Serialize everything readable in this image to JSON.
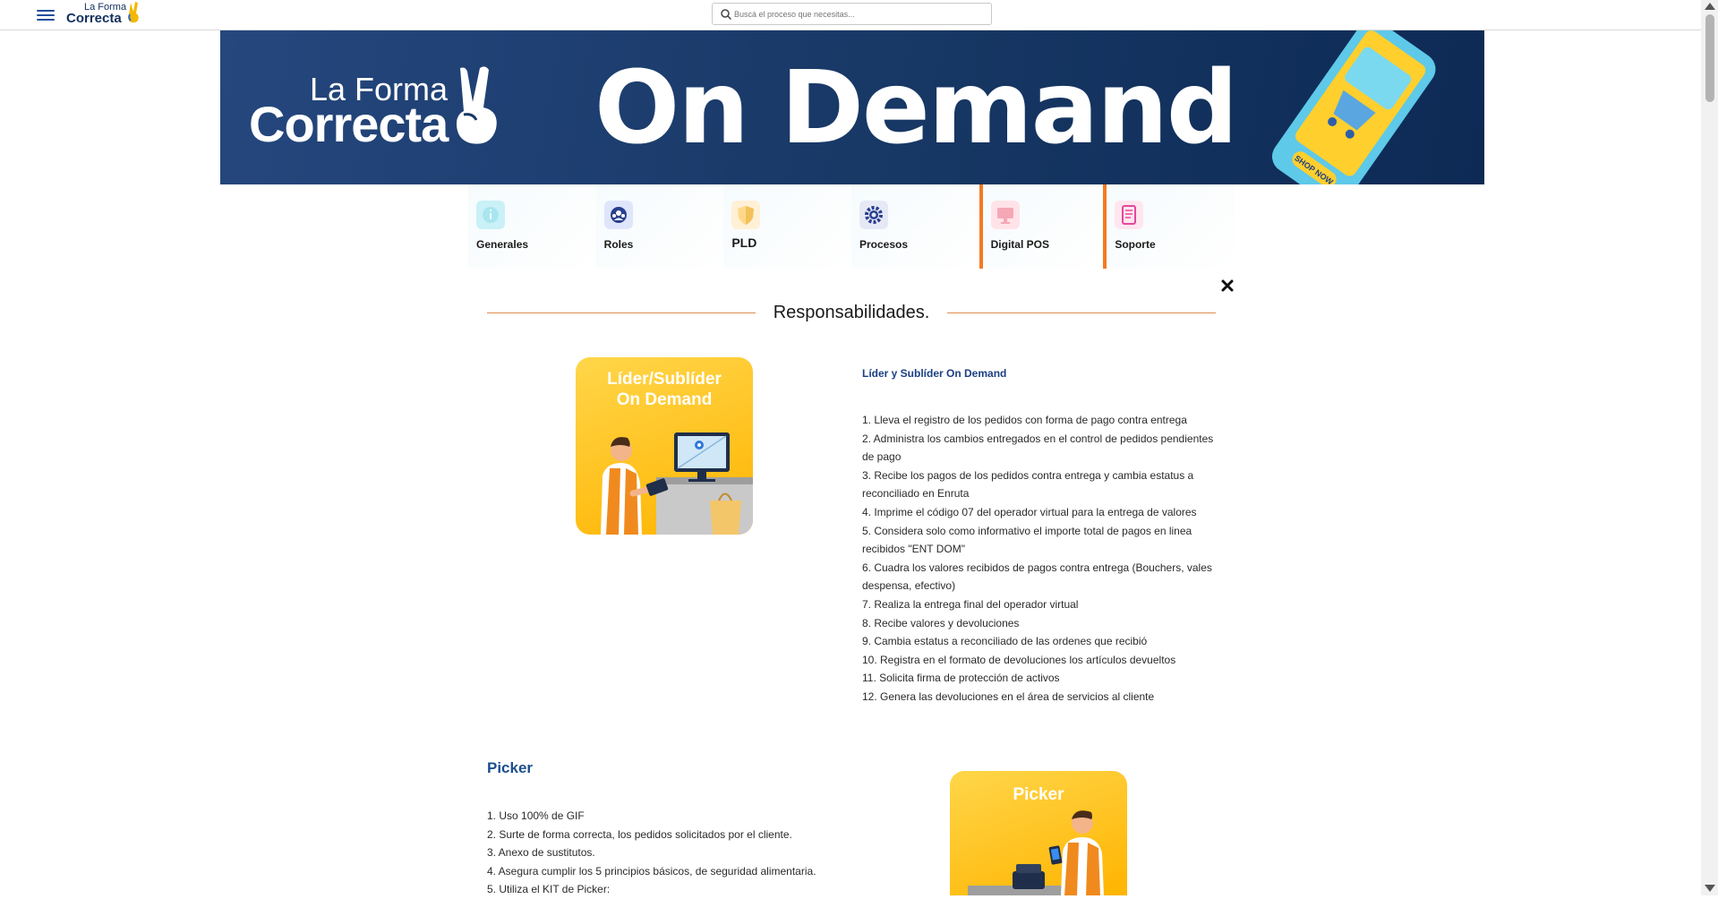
{
  "header": {
    "brand_line1": "La Forma",
    "brand_line2": "Correcta",
    "search_placeholder": "Buscá el proceso que necesitas..."
  },
  "banner": {
    "logo_line1": "La Forma",
    "logo_line2": "Correcta",
    "title": "On Demand",
    "phone_button": "SHOP NOW"
  },
  "tabs": [
    {
      "label": "Generales",
      "icon": "info-icon",
      "color": "#a8e6f0"
    },
    {
      "label": "Roles",
      "icon": "people-icon",
      "color": "#c9d6f5"
    },
    {
      "label": "PLD",
      "icon": "shield-icon",
      "color": "#ffe1a8"
    },
    {
      "label": "Procesos",
      "icon": "gear-icon",
      "color": "#d7dcef"
    },
    {
      "label": "Digital POS",
      "icon": "monitor-icon",
      "color": "#ffd0d8"
    },
    {
      "label": "Soporte",
      "icon": "document-icon",
      "color": "#ffd6e6"
    }
  ],
  "section": {
    "title": "Responsabilidades."
  },
  "roles": [
    {
      "card_title_line1": "Líder/Sublíder",
      "card_title_line2": "On Demand",
      "heading": "Líder y Sublíder On Demand",
      "items": [
        "1. Lleva el registro de los pedidos con forma de pago contra entrega",
        "2. Administra los cambios entregados en el control de pedidos pendientes de pago",
        "3. Recibe los pagos de los pedidos contra entrega y cambia estatus a reconciliado en Enruta",
        "4. Imprime el código 07 del operador virtual para la entrega de valores",
        "5. Considera solo como informativo el importe total de pagos en linea recibidos \"ENT DOM\"",
        "6. Cuadra los valores recibidos de pagos contra entrega (Bouchers, vales despensa, efectivo)",
        "7. Realiza la entrega final del operador virtual",
        "8. Recibe valores y devoluciones",
        "9. Cambia estatus a reconciliado de las ordenes que recibió",
        "10. Registra en el formato de devoluciones los artículos devueltos",
        "11. Solicita firma de protección de activos",
        "12. Genera las devoluciones en el área de servicios al cliente"
      ]
    },
    {
      "card_title": "Picker",
      "heading": "Picker",
      "items": [
        "1. Uso 100% de GIF",
        "2. Surte de forma correcta, los pedidos solicitados por el cliente.",
        "3. Anexo de sustitutos.",
        "4. Asegura cumplir los 5 principios básicos, de seguridad  alimentaria.",
        "5. Utiliza el KIT de Picker:"
      ]
    }
  ],
  "colors": {
    "brand_blue": "#1b3f84",
    "accent_orange": "#f47a20",
    "banner_bg": "#173764",
    "card_yellow": "#ffbe1a"
  }
}
